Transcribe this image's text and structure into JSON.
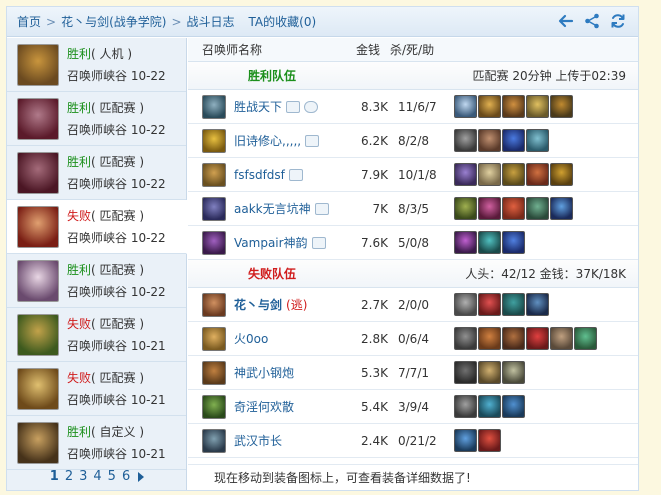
{
  "nav": {
    "breadcrumb": [
      {
        "label": "首页"
      },
      {
        "label": "花丶与剑(战争学院)"
      },
      {
        "label": "战斗日志"
      }
    ],
    "favorites_label": "TA的收藏(0)",
    "icons": [
      "back-arrow-icon",
      "share-icon",
      "refresh-icon"
    ]
  },
  "sidebar": {
    "matches": [
      {
        "result": "胜利",
        "mode": "( 人机 )",
        "map": "召唤师峡谷 10-22",
        "win": true,
        "portrait": [
          "#6b4a20",
          "#c9953d"
        ]
      },
      {
        "result": "胜利",
        "mode": "( 匹配赛 )",
        "map": "召唤师峡谷 10-22",
        "win": true,
        "portrait": [
          "#5b1a2a",
          "#b07a8a"
        ]
      },
      {
        "result": "胜利",
        "mode": "( 匹配赛 )",
        "map": "召唤师峡谷 10-22",
        "win": true,
        "portrait": [
          "#4b1624",
          "#a46b7a"
        ]
      },
      {
        "result": "失败",
        "mode": "( 匹配赛 )",
        "map": "召唤师峡谷 10-22",
        "win": false,
        "portrait": [
          "#7a1e14",
          "#e0a070"
        ]
      },
      {
        "result": "胜利",
        "mode": "( 匹配赛 )",
        "map": "召唤师峡谷 10-22",
        "win": true,
        "portrait": [
          "#6a4a6e",
          "#e8d6e4"
        ]
      },
      {
        "result": "失败",
        "mode": "( 匹配赛 )",
        "map": "召唤师峡谷 10-21",
        "win": false,
        "portrait": [
          "#3d5a1e",
          "#c2a24a"
        ]
      },
      {
        "result": "失败",
        "mode": "( 匹配赛 )",
        "map": "召唤师峡谷 10-21",
        "win": false,
        "portrait": [
          "#6e4a1a",
          "#e0c070"
        ]
      },
      {
        "result": "胜利",
        "mode": "( 自定义 )",
        "map": "召唤师峡谷 10-21",
        "win": true,
        "portrait": [
          "#46321a",
          "#c8a060"
        ]
      }
    ],
    "pages": [
      "1",
      "2",
      "3",
      "4",
      "5",
      "6"
    ],
    "current_page": "1"
  },
  "table": {
    "col_name": "召唤师名称",
    "col_gold": "金钱",
    "col_kda": "杀/死/助"
  },
  "win_team": {
    "title": "胜利队伍",
    "info": "匹配赛 20分钟 上传于02:39",
    "players": [
      {
        "name": "胜战天下",
        "gold": "8.3K",
        "kda": "11/6/7",
        "avatar": [
          "#2a4b5a",
          "#8fb0c0"
        ],
        "tags": 2,
        "items": [
          [
            "#3a5a7a",
            "#c0d8f0"
          ],
          [
            "#6a4a1a",
            "#e0b050"
          ],
          [
            "#5a3a1a",
            "#d09040"
          ],
          [
            "#6a5a2a",
            "#e0c060"
          ],
          [
            "#4a3a1a",
            "#c08a30"
          ]
        ]
      },
      {
        "name": "旧诗修心,,,,,",
        "gold": "6.2K",
        "kda": "8/2/8",
        "avatar": [
          "#7a5a10",
          "#e8c040"
        ],
        "tags": 1,
        "items": [
          [
            "#3a3a3a",
            "#a0a0a0"
          ],
          [
            "#5a3a2a",
            "#c09070"
          ],
          [
            "#1a2a6a",
            "#4a7ae0"
          ],
          [
            "#2a5a6a",
            "#80c0d0"
          ]
        ]
      },
      {
        "name": "fsfsdfdsf",
        "gold": "7.9K",
        "kda": "10/1/8",
        "avatar": [
          "#6a5020",
          "#d0a050"
        ],
        "tags": 1,
        "items": [
          [
            "#3a2a5a",
            "#9a80d0"
          ],
          [
            "#7a6a4a",
            "#e0d0a0"
          ],
          [
            "#5a4a1a",
            "#c8a040"
          ],
          [
            "#6a2a1a",
            "#d07040"
          ],
          [
            "#5a4010",
            "#d0a030"
          ]
        ]
      },
      {
        "name": "aakk无言坑神",
        "gold": "7K",
        "kda": "8/3/5",
        "avatar": [
          "#2a2a5a",
          "#8080c0"
        ],
        "tags": 1,
        "items": [
          [
            "#3a4a1a",
            "#a0b050"
          ],
          [
            "#5a1a3a",
            "#d060a0"
          ],
          [
            "#7a2a1a",
            "#e06040"
          ],
          [
            "#2a4a3a",
            "#70b090"
          ],
          [
            "#1a2a5a",
            "#60a0e0"
          ]
        ]
      },
      {
        "name": "Vampair神韵",
        "gold": "7.6K",
        "kda": "5/0/8",
        "avatar": [
          "#3a1a4a",
          "#a060c0"
        ],
        "tags": 1,
        "items": [
          [
            "#3a1a4a",
            "#c060d0"
          ],
          [
            "#1a4a4a",
            "#50c0c0"
          ],
          [
            "#1a2a6a",
            "#5080e0"
          ]
        ]
      }
    ]
  },
  "lose_team": {
    "title": "失败队伍",
    "info": "人头：42/12 金钱：37K/18K",
    "players": [
      {
        "name": "花丶与剑",
        "flee": "(逃)",
        "gold": "2.7K",
        "kda": "2/0/0",
        "avatar": [
          "#6a3a20",
          "#d09060"
        ],
        "tags": 0,
        "bold": true,
        "items": [
          [
            "#4a4a4a",
            "#b0b0b0"
          ],
          [
            "#6a1a1a",
            "#e05050"
          ],
          [
            "#1a4a4a",
            "#40a0a0"
          ],
          [
            "#1a2a4a",
            "#6090c0"
          ]
        ]
      },
      {
        "name": "火0oo",
        "flee": "",
        "gold": "2.8K",
        "kda": "0/6/4",
        "avatar": [
          "#7a5a20",
          "#e0b060"
        ],
        "tags": 0,
        "items": [
          [
            "#3a3a3a",
            "#909090"
          ],
          [
            "#6a3a1a",
            "#d08040"
          ],
          [
            "#4a2a1a",
            "#b07040"
          ],
          [
            "#6a1a1a",
            "#e04040"
          ],
          [
            "#5a4a3a",
            "#c0a080"
          ],
          [
            "#2a5a3a",
            "#60c090"
          ]
        ]
      },
      {
        "name": "神武小钢炮",
        "flee": "",
        "gold": "5.3K",
        "kda": "7/7/1",
        "avatar": [
          "#5a3a1a",
          "#c08040"
        ],
        "tags": 0,
        "items": [
          [
            "#2a2a2a",
            "#707070"
          ],
          [
            "#5a4a2a",
            "#d0b070"
          ],
          [
            "#4a4a3a",
            "#c0c0a0"
          ]
        ]
      },
      {
        "name": "奇淫何欢散",
        "flee": "",
        "gold": "5.4K",
        "kda": "3/9/4",
        "avatar": [
          "#2a4a1a",
          "#80b050"
        ],
        "tags": 0,
        "items": [
          [
            "#3a3a3a",
            "#a0a0a0"
          ],
          [
            "#1a4a5a",
            "#50b0d0"
          ],
          [
            "#1a3a5a",
            "#5090d0"
          ]
        ]
      },
      {
        "name": "武汉市长",
        "flee": "",
        "gold": "2.4K",
        "kda": "0/21/2",
        "avatar": [
          "#2a3a4a",
          "#80a0b0"
        ],
        "tags": 0,
        "items": [
          [
            "#1a3a5a",
            "#60a0e0"
          ],
          [
            "#6a1a1a",
            "#e05040"
          ]
        ]
      }
    ]
  },
  "footnote": "现在移动到装备图标上，可查看装备详细数据了!"
}
